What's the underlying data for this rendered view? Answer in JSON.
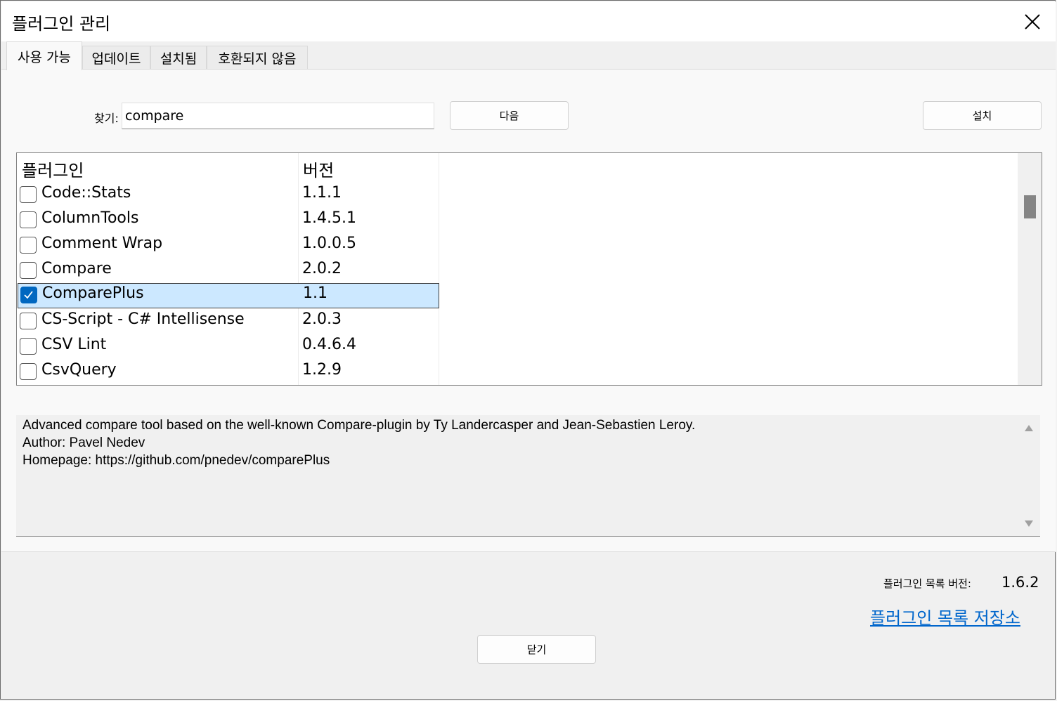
{
  "window": {
    "title": "플러그인 관리"
  },
  "tabs": [
    {
      "label": "사용 가능",
      "active": true
    },
    {
      "label": "업데이트",
      "active": false
    },
    {
      "label": "설치됨",
      "active": false
    },
    {
      "label": "호환되지 않음",
      "active": false
    }
  ],
  "search": {
    "label": "찾기:",
    "value": "compare"
  },
  "buttons": {
    "next": "다음",
    "install": "설치",
    "close": "닫기"
  },
  "table": {
    "headers": {
      "plugin": "플러그인",
      "version": "버전"
    },
    "rows": [
      {
        "name": "Code::Stats",
        "version": "1.1.1",
        "checked": false,
        "selected": false
      },
      {
        "name": "ColumnTools",
        "version": "1.4.5.1",
        "checked": false,
        "selected": false
      },
      {
        "name": "Comment Wrap",
        "version": "1.0.0.5",
        "checked": false,
        "selected": false
      },
      {
        "name": "Compare",
        "version": "2.0.2",
        "checked": false,
        "selected": false
      },
      {
        "name": "ComparePlus",
        "version": "1.1",
        "checked": true,
        "selected": true
      },
      {
        "name": "CS-Script - C# Intellisense",
        "version": "2.0.3",
        "checked": false,
        "selected": false
      },
      {
        "name": "CSV Lint",
        "version": "0.4.6.4",
        "checked": false,
        "selected": false
      },
      {
        "name": "CsvQuery",
        "version": "1.2.9",
        "checked": false,
        "selected": false
      }
    ]
  },
  "description": {
    "lines": [
      "Advanced compare tool based on the well-known Compare-plugin by Ty Landercasper and Jean-Sebastien Leroy.",
      "Author: Pavel Nedev",
      "Homepage: https://github.com/pnedev/comparePlus"
    ]
  },
  "footer": {
    "list_version_label": "플러그인 목록 버전:",
    "list_version_value": "1.6.2",
    "repo_link": "플러그인 목록 저장소"
  },
  "colors": {
    "selection": "#cce8ff",
    "checkbox_accent": "#0067c0",
    "link": "#0066cc"
  },
  "icons": {
    "close": "close-icon",
    "check": "checkmark-icon"
  }
}
